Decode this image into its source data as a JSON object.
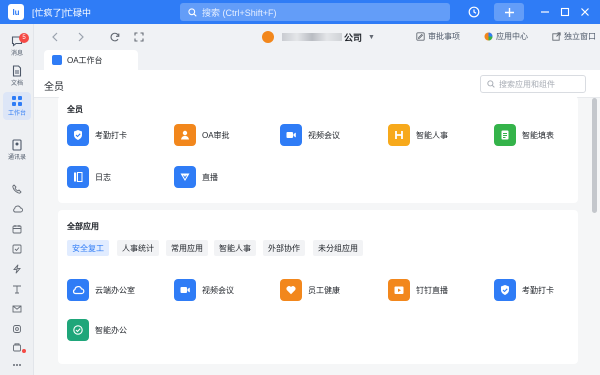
{
  "window": {
    "title": "[忙疯了]忙碌中",
    "logo_text": "Iu",
    "search_placeholder": "搜索 (Ctrl+Shift+F)"
  },
  "rail": {
    "items": [
      {
        "label": "消息",
        "icon": "message-icon",
        "badge": "5"
      },
      {
        "label": "文档",
        "icon": "document-icon"
      },
      {
        "label": "工作台",
        "icon": "workbench-grid-icon",
        "active": true
      },
      {
        "label": "通讯录",
        "icon": "contacts-icon"
      }
    ],
    "small_icons": [
      "phone-icon",
      "cloud-icon",
      "calendar-icon",
      "todo-check-icon",
      "lightning-icon",
      "tag-icon",
      "mail-icon",
      "shield-icon",
      "box-icon",
      "more-icon"
    ]
  },
  "toolbar": {
    "company_suffix": "公司",
    "links": {
      "approvals": "审批事项",
      "app_center": "应用中心",
      "standalone": "独立窗口"
    }
  },
  "tab": {
    "label": "OA工作台"
  },
  "main": {
    "title": "全员",
    "search_placeholder": "搜索应用和组件"
  },
  "section1": {
    "title": "全员",
    "apps": [
      {
        "name": "考勤打卡",
        "color": "#2f7cf6",
        "icon": "attendance-icon"
      },
      {
        "name": "OA审批",
        "color": "#f2871c",
        "icon": "approval-icon"
      },
      {
        "name": "视频会议",
        "color": "#2f7cf6",
        "icon": "video-meeting-icon"
      },
      {
        "name": "智能人事",
        "color": "#f7a91b",
        "icon": "hr-icon"
      },
      {
        "name": "智能填表",
        "color": "#34b34a",
        "icon": "form-icon"
      },
      {
        "name": "日志",
        "color": "#2f7cf6",
        "icon": "log-icon"
      },
      {
        "name": "直播",
        "color": "#2f7cf6",
        "icon": "live-icon"
      }
    ]
  },
  "section2": {
    "title": "全部应用",
    "filters": [
      "安全复工",
      "人事统计",
      "常用应用",
      "智能人事",
      "外部协作",
      "未分组应用"
    ],
    "apps": [
      {
        "name": "云端办公室",
        "color": "#2f7cf6",
        "icon": "cloud-office-icon"
      },
      {
        "name": "视频会议",
        "color": "#2f7cf6",
        "icon": "video-meeting-icon"
      },
      {
        "name": "员工健康",
        "color": "#f2871c",
        "icon": "heart-icon"
      },
      {
        "name": "钉钉直播",
        "color": "#f2871c",
        "icon": "live-stream-icon"
      },
      {
        "name": "考勤打卡",
        "color": "#2f7cf6",
        "icon": "attendance-icon"
      },
      {
        "name": "智能办公",
        "color": "#1fa67a",
        "icon": "smart-office-icon"
      }
    ]
  }
}
